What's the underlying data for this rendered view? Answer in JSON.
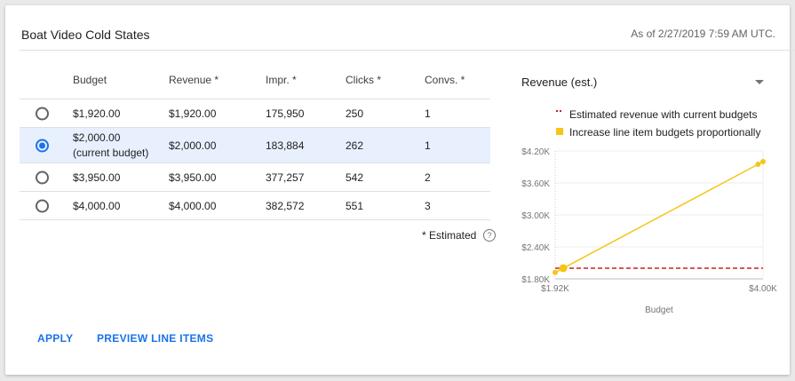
{
  "header": {
    "title": "Boat Video Cold States",
    "as_of": "As of 2/27/2019 7:59 AM UTC."
  },
  "table": {
    "columns": [
      "Budget",
      "Revenue *",
      "Impr. *",
      "Clicks *",
      "Convs. *"
    ],
    "rows": [
      {
        "budget": "$1,920.00",
        "budget_note": "",
        "revenue": "$1,920.00",
        "impr": "175,950",
        "clicks": "250",
        "convs": "1",
        "selected": false
      },
      {
        "budget": "$2,000.00",
        "budget_note": "(current budget)",
        "revenue": "$2,000.00",
        "impr": "183,884",
        "clicks": "262",
        "convs": "1",
        "selected": true
      },
      {
        "budget": "$3,950.00",
        "budget_note": "",
        "revenue": "$3,950.00",
        "impr": "377,257",
        "clicks": "542",
        "convs": "2",
        "selected": false
      },
      {
        "budget": "$4,000.00",
        "budget_note": "",
        "revenue": "$4,000.00",
        "impr": "382,572",
        "clicks": "551",
        "convs": "3",
        "selected": false
      }
    ],
    "estimated_note": "* Estimated"
  },
  "actions": {
    "apply": "APPLY",
    "preview": "PREVIEW LINE ITEMS"
  },
  "chart_panel": {
    "metric_selected": "Revenue (est.)",
    "icons": {
      "dropdown": "chevron-down-icon",
      "help": "help-circle-icon"
    }
  },
  "chart_data": {
    "type": "line",
    "xlabel": "Budget",
    "ylabel": "",
    "x_ticks": [
      "$1.92K",
      "$4.00K"
    ],
    "y_ticks": [
      "$4.20K",
      "$3.60K",
      "$3.00K",
      "$2.40K",
      "$1.80K"
    ],
    "ylim": [
      1800,
      4200
    ],
    "xlim": [
      1920,
      4000
    ],
    "grid": true,
    "legend_position": "top",
    "series": [
      {
        "name": "Estimated revenue with current budgets",
        "style": "dashed",
        "color": "#c5221f",
        "x": [
          1920,
          4000
        ],
        "y": [
          2000,
          2000
        ]
      },
      {
        "name": "Increase line item budgets proportionally",
        "style": "solid",
        "color": "#f5c518",
        "x": [
          1920,
          2000,
          3950,
          4000
        ],
        "y": [
          1920,
          2000,
          3950,
          4000
        ]
      }
    ]
  }
}
